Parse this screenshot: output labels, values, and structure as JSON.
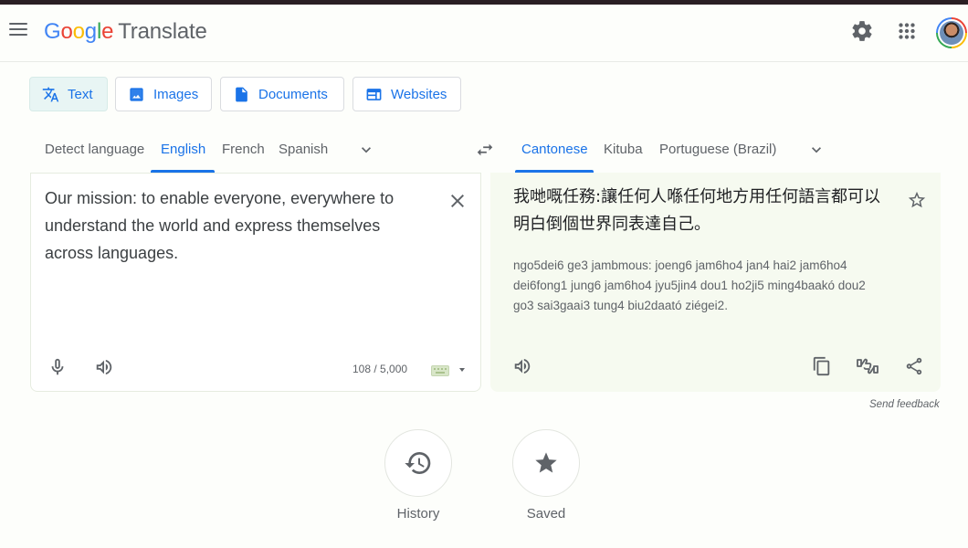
{
  "header": {
    "logo_letters": [
      "G",
      "o",
      "o",
      "g",
      "l",
      "e"
    ],
    "product_name": "Translate",
    "icons": [
      "menu-icon",
      "settings-gear-icon",
      "apps-grid-icon",
      "account-avatar"
    ]
  },
  "mode_tabs": [
    {
      "label": "Text",
      "icon": "translate-icon",
      "active": true
    },
    {
      "label": "Images",
      "icon": "image-icon",
      "active": false
    },
    {
      "label": "Documents",
      "icon": "document-icon",
      "active": false
    },
    {
      "label": "Websites",
      "icon": "website-icon",
      "active": false
    }
  ],
  "source_languages": [
    {
      "label": "Detect language",
      "active": false
    },
    {
      "label": "English",
      "active": true
    },
    {
      "label": "French",
      "active": false
    },
    {
      "label": "Spanish",
      "active": false
    }
  ],
  "target_languages": [
    {
      "label": "Cantonese",
      "active": true
    },
    {
      "label": "Kituba",
      "active": false
    },
    {
      "label": "Portuguese (Brazil)",
      "active": false
    }
  ],
  "source": {
    "text": "Our mission: to enable everyone, everywhere to understand the world and express themselves across languages.",
    "char_count": "108 / 5,000"
  },
  "target": {
    "text": "我哋嘅任務:讓任何人喺任何地方用任何語言都可以明白倒個世界同表達自己。",
    "romanization": "ngo5dei6 ge3 jambmous: joeng6 jam6ho4 jan4 hai2 jam6ho4 dei6fong1 jung6 jam6ho4 jyu5jin4 dou1 ho2ji5 ming4baakó dou2 go3 sai3gaai3 tung4 biu2daató ziégei2."
  },
  "feedback_link": "Send feedback",
  "bottom_buttons": [
    {
      "label": "History",
      "icon": "history-icon"
    },
    {
      "label": "Saved",
      "icon": "star-icon"
    }
  ],
  "colors": {
    "accent": "#1a73e8",
    "active_tab_bg": "#e8f5f4",
    "target_panel_bg": "#f6faf0",
    "icon_gray": "#5f6368"
  }
}
